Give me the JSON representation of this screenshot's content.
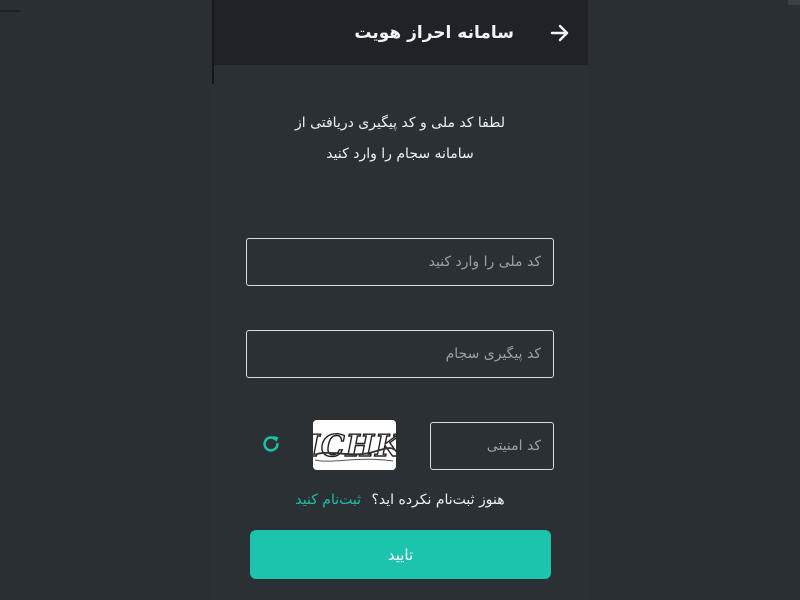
{
  "header": {
    "title": "سامانه احراز هویت",
    "back_icon": "arrow-right-icon"
  },
  "intro": {
    "line1": "لطفا کد ملی و کد پیگیری دریافتی از",
    "line2": "سامانه سجام را وارد کنید"
  },
  "form": {
    "national_code": {
      "value": "",
      "placeholder": "کد ملی را وارد کنید"
    },
    "tracking_code": {
      "value": "",
      "placeholder": "کد پیگیری سجام"
    },
    "security_code": {
      "value": "",
      "placeholder": "کد امنیتی"
    },
    "captcha_text": "ICHK",
    "refresh_icon": "refresh-icon"
  },
  "signup": {
    "question": "هنوز ثبت‌نام نکرده اید؟",
    "link": "ثبت‌نام کنید"
  },
  "submit": {
    "label": "تایید"
  },
  "colors": {
    "background": "#2b3035",
    "header": "#1f2327",
    "accent": "#1cc3ad",
    "text": "#eef0f2",
    "field_border": "#d8dadc"
  }
}
